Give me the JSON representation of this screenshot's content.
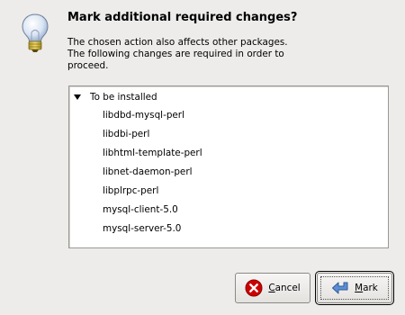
{
  "dialog": {
    "title": "Mark additional required changes?",
    "message": "The chosen action also affects other packages.\nThe following changes are required in order to\nproceed.",
    "icon": "lightbulb-icon"
  },
  "changes": {
    "group_label": "To be installed",
    "group_expander_icon": "triangle-down-icon",
    "packages": [
      "libdbd-mysql-perl",
      "libdbi-perl",
      "libhtml-template-perl",
      "libnet-daemon-perl",
      "libplrpc-perl",
      "mysql-client-5.0",
      "mysql-server-5.0"
    ]
  },
  "buttons": {
    "cancel_label": "Cancel",
    "cancel_icon": "cancel-icon",
    "mark_label": "Mark",
    "mark_icon": "mark-arrow-icon"
  },
  "colors": {
    "background": "#edeceb",
    "cancel_icon": "#cc0000",
    "mark_icon": "#5b8fd6"
  }
}
